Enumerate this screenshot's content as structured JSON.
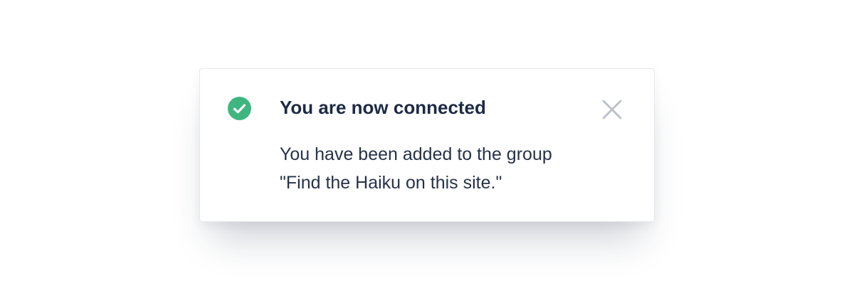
{
  "notification": {
    "title": "You are now connected",
    "message_line_1": "You have been added to the group",
    "message_line_2": "\"Find the Haiku on this site.\"",
    "status_icon": "check-circle-icon",
    "close_icon": "close-icon"
  },
  "colors": {
    "success": "#3fb67f",
    "title_text": "#1d2a44",
    "body_text": "#27324a",
    "close_icon": "#b9c0cc",
    "border": "#e6e9ee"
  }
}
